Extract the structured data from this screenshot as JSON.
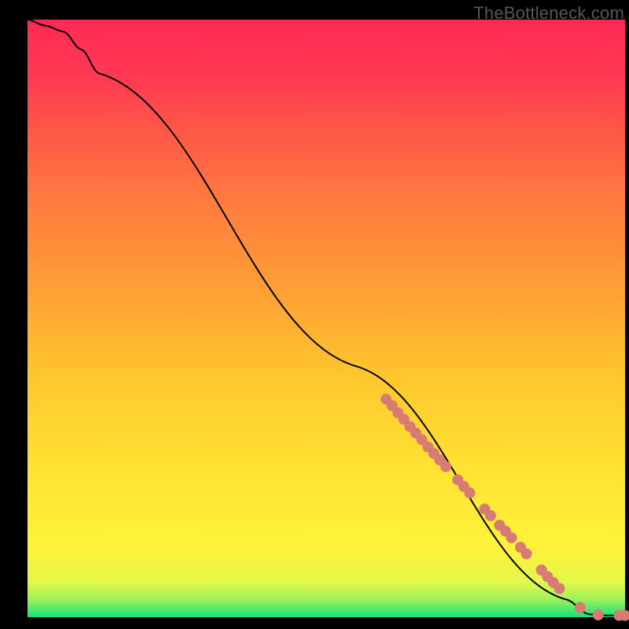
{
  "watermark_text": "TheBottleneck.com",
  "chart_data": {
    "type": "line",
    "title": "",
    "xlabel": "",
    "ylabel": "",
    "xlim": [
      0,
      100
    ],
    "ylim": [
      0,
      100
    ],
    "series": [
      {
        "name": "curve",
        "x": [
          0,
          3,
          6,
          9,
          12,
          55,
          90,
          94,
          97,
          100
        ],
        "y": [
          100,
          99,
          98,
          95,
          91,
          42,
          3,
          0.5,
          0.3,
          0.3
        ]
      }
    ],
    "markers": {
      "name": "points",
      "color": "#d87b74",
      "x": [
        60,
        61,
        62,
        63,
        64,
        65,
        66,
        67,
        68,
        69,
        70,
        72,
        73,
        74,
        76.5,
        77.5,
        79,
        80,
        81,
        82.5,
        83.5,
        86,
        87,
        88,
        89,
        92.5,
        95.5,
        99,
        100
      ],
      "y": [
        36.5,
        35.4,
        34.2,
        33.1,
        31.9,
        30.8,
        29.7,
        28.5,
        27.4,
        26.3,
        25.2,
        23.0,
        21.9,
        20.8,
        18.1,
        17.0,
        15.4,
        14.4,
        13.3,
        11.7,
        10.6,
        7.9,
        6.8,
        5.8,
        4.8,
        1.6,
        0.4,
        0.3,
        0.3
      ]
    }
  }
}
